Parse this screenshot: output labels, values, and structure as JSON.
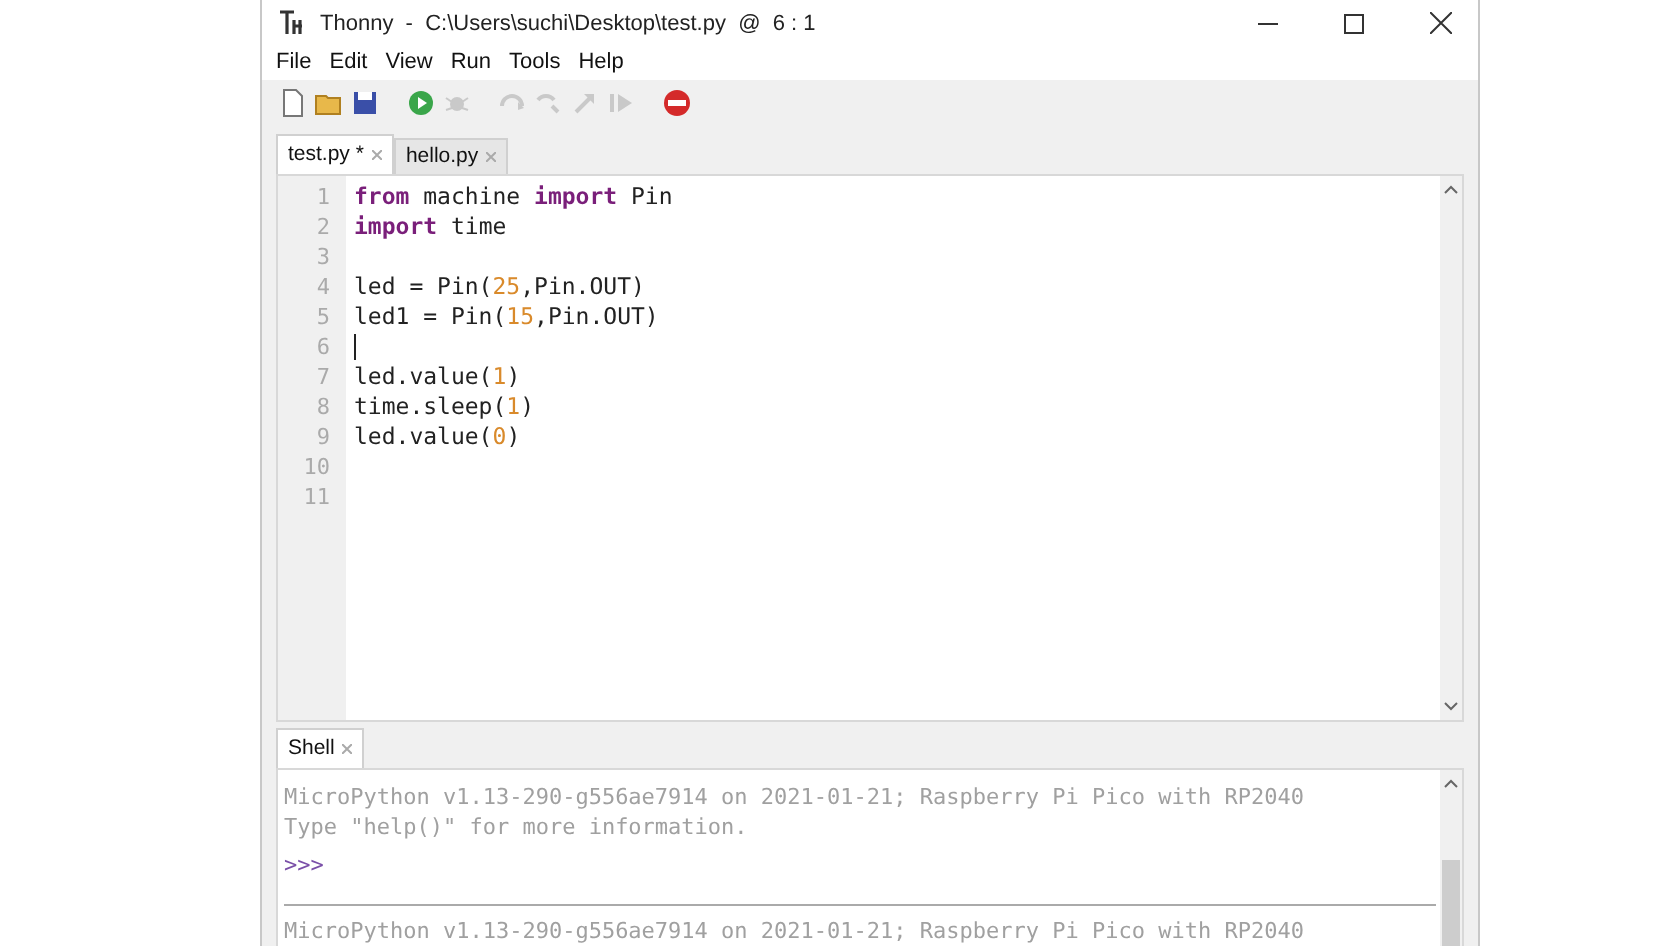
{
  "window": {
    "title": "Thonny  -  C:\\Users\\suchi\\Desktop\\test.py  @  6 : 1"
  },
  "menu": [
    "File",
    "Edit",
    "View",
    "Run",
    "Tools",
    "Help"
  ],
  "toolbar": [
    {
      "kind": "new",
      "disabled": false
    },
    {
      "kind": "open",
      "disabled": false
    },
    {
      "kind": "save",
      "disabled": false
    },
    {
      "kind": "run",
      "disabled": false
    },
    {
      "kind": "debug",
      "disabled": true
    },
    {
      "kind": "step-over",
      "disabled": true
    },
    {
      "kind": "step-into",
      "disabled": true
    },
    {
      "kind": "step-out",
      "disabled": true
    },
    {
      "kind": "resume",
      "disabled": true
    },
    {
      "kind": "stop",
      "disabled": false
    }
  ],
  "tabs": [
    {
      "label": "test.py *",
      "selected": true
    },
    {
      "label": "hello.py",
      "selected": false
    }
  ],
  "editor": {
    "lines": [
      {
        "number": "1",
        "cursor": false,
        "tokens": [
          {
            "text": "from",
            "kind": "kw"
          },
          {
            "text": " machine ",
            "kind": "plain"
          },
          {
            "text": "import",
            "kind": "kw"
          },
          {
            "text": " Pin",
            "kind": "plain"
          }
        ]
      },
      {
        "number": "2",
        "cursor": false,
        "tokens": [
          {
            "text": "import",
            "kind": "kw"
          },
          {
            "text": " time",
            "kind": "plain"
          }
        ]
      },
      {
        "number": "3",
        "cursor": false
      },
      {
        "number": "4",
        "cursor": false,
        "tokens": [
          {
            "text": "led = Pin(",
            "kind": "plain"
          },
          {
            "text": "25",
            "kind": "num"
          },
          {
            "text": ",Pin.OUT)",
            "kind": "plain"
          }
        ]
      },
      {
        "number": "5",
        "cursor": false,
        "tokens": [
          {
            "text": "led1 = Pin(",
            "kind": "plain"
          },
          {
            "text": "15",
            "kind": "num"
          },
          {
            "text": ",Pin.OUT)",
            "kind": "plain"
          }
        ]
      },
      {
        "number": "6",
        "cursor": true
      },
      {
        "number": "7",
        "cursor": false,
        "tokens": [
          {
            "text": "led.value(",
            "kind": "plain"
          },
          {
            "text": "1",
            "kind": "num"
          },
          {
            "text": ")",
            "kind": "plain"
          }
        ]
      },
      {
        "number": "8",
        "cursor": false,
        "tokens": [
          {
            "text": "time.sleep(",
            "kind": "plain"
          },
          {
            "text": "1",
            "kind": "num"
          },
          {
            "text": ")",
            "kind": "plain"
          }
        ]
      },
      {
        "number": "9",
        "cursor": false,
        "tokens": [
          {
            "text": "led.value(",
            "kind": "plain"
          },
          {
            "text": "0",
            "kind": "num"
          },
          {
            "text": ")",
            "kind": "plain"
          }
        ]
      },
      {
        "number": "10",
        "cursor": false
      },
      {
        "number": "11",
        "cursor": false
      }
    ]
  },
  "shell": {
    "tab": {
      "label": "Shell",
      "selected": true
    },
    "output": [
      "MicroPython v1.13-290-g556ae7914 on 2021-01-21; Raspberry Pi Pico with RP2040",
      "Type \"help()\" for more information."
    ],
    "prompt": ">>>",
    "output_after": [
      "MicroPython v1.13-290-g556ae7914 on 2021-01-21; Raspberry Pi Pico with RP2040"
    ]
  }
}
